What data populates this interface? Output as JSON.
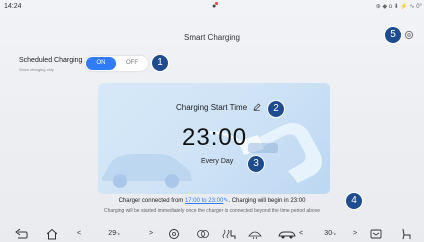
{
  "status": {
    "time": "14:24",
    "app_indicator": "●",
    "icons": "⊕ ◆ ɑ ⬇ ⚡ ∿ 0°"
  },
  "page": {
    "title": "Smart Charging"
  },
  "scheduled": {
    "label": "Scheduled Charging",
    "sublabel": "Show charging only",
    "toggle_on": "ON",
    "toggle_off": "OFF",
    "state": "on"
  },
  "card": {
    "start_time_label": "Charging Start Time",
    "time": "23:00",
    "repeat": "Every Day"
  },
  "info": {
    "prefix": "Charger connected from ",
    "range_link": "17:00 to 23:00",
    "suffix": ". Charging will begin in 23:00",
    "note": "Charging will be started immediately once the charger is connected beyond the time period above"
  },
  "callouts": [
    "1",
    "2",
    "3",
    "4",
    "5"
  ],
  "navbar": {
    "left_temp": "29",
    "left_temp_unit": "°c",
    "right_temp": "30",
    "right_temp_unit": "°c",
    "left_arrow": "<",
    "right_arrow": ">",
    "icons": [
      "back-icon",
      "home-icon",
      "fan-icon",
      "ac-icon",
      "seat-heat-icon",
      "defrost-icon",
      "car-icon",
      "display-icon",
      "seat-icon"
    ]
  },
  "colors": {
    "accent": "#2f7cf6",
    "callout": "#1f4b8f",
    "card": "#cfe3f6"
  }
}
